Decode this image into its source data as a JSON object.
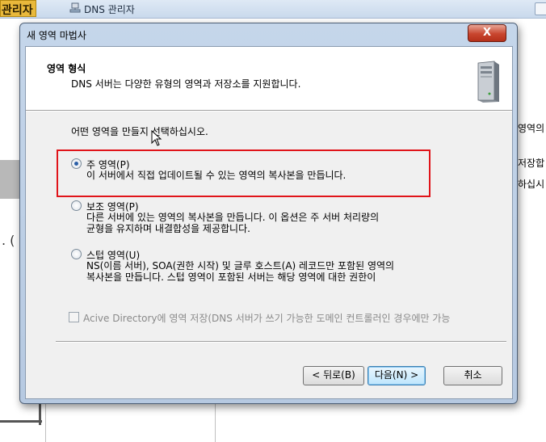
{
  "background": {
    "left_title": "관리자",
    "app_title": "DNS 관리자",
    "right_fragments": [
      "영역의",
      "저장합",
      "하십시"
    ],
    "left_fragment": ". ("
  },
  "wizard": {
    "title": "새 영역 마법사",
    "close_label": "X",
    "header": {
      "title": "영역 형식",
      "subtitle": "DNS 서버는 다양한 유형의 영역과 저장소를 지원합니다."
    },
    "question": "어떤 영역을 만들지 선택하십시오.",
    "options": [
      {
        "label": "주 영역(P)",
        "checked": true,
        "description": [
          "이 서버에서 직접 업데이트될 수 있는 영역의 복사본을 만듭니다."
        ]
      },
      {
        "label": "보조 영역(P)",
        "checked": false,
        "description": [
          "다른 서버에 있는 영역의 복사본을 만듭니다. 이 옵션은 주 서버 처리량의",
          "균형을 유지하며 내결합성을 제공합니다."
        ]
      },
      {
        "label": "스텁 영역(U)",
        "checked": false,
        "description": [
          "NS(이름 서버), SOA(권한 시작) 및 글루 호스트(A) 레코드만 포함된 영역의",
          "복사본을 만듭니다. 스텁 영역이 포함된 서버는 해당 영역에 대한 권한이"
        ]
      }
    ],
    "ad_checkbox": {
      "label": "Acive Directory에 영역 저장(DNS 서버가 쓰기 가능한 도메인 컨트롤러인 경우에만 가능",
      "checked": false,
      "enabled": false
    },
    "buttons": {
      "back": "< 뒤로(B)",
      "next": "다음(N) >",
      "cancel": "취소"
    }
  }
}
